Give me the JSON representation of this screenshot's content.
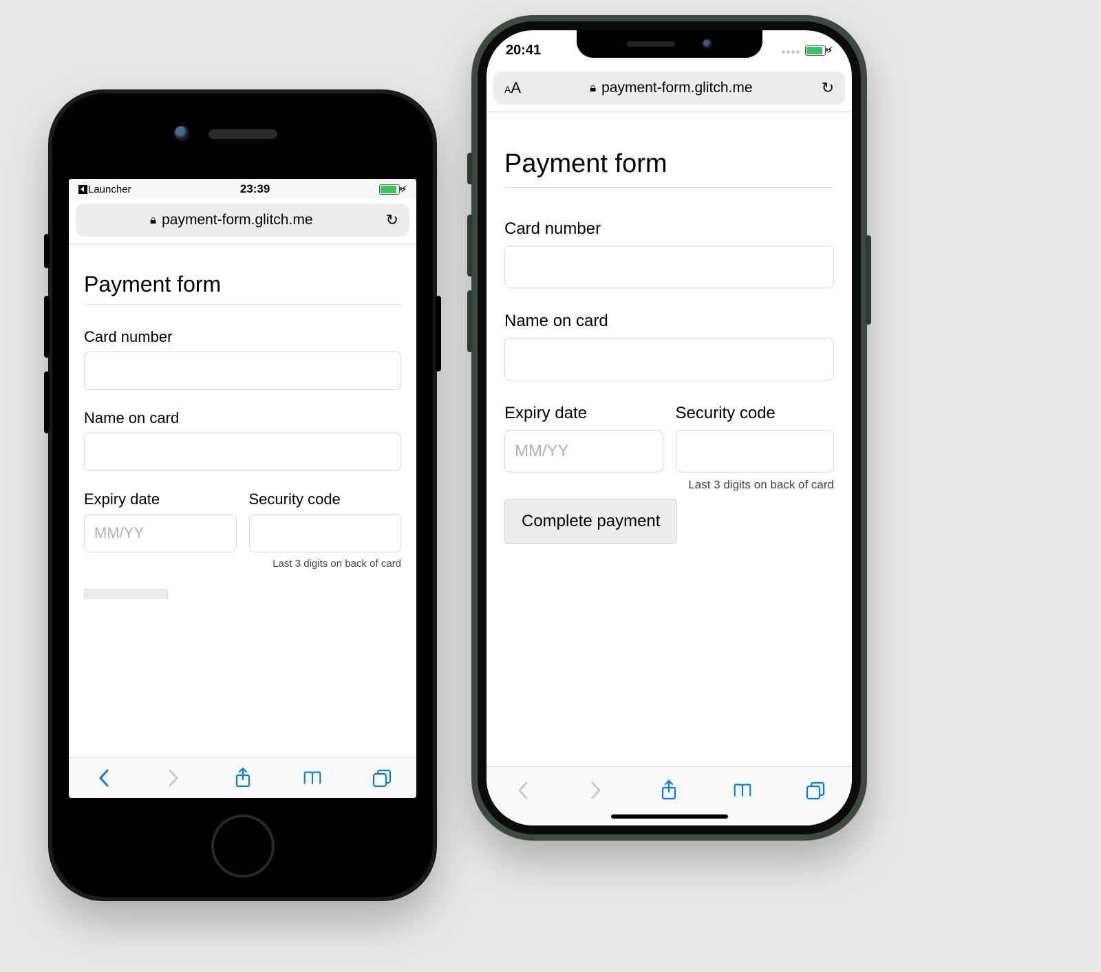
{
  "left": {
    "status": {
      "back_label": "Launcher",
      "time": "23:39"
    },
    "urlbar": {
      "host": "payment-form.glitch.me"
    },
    "form": {
      "heading": "Payment form",
      "card_number_label": "Card number",
      "name_label": "Name on card",
      "expiry_label": "Expiry date",
      "expiry_placeholder": "MM/YY",
      "cvc_label": "Security code",
      "cvc_hint": "Last 3 digits on back of card"
    }
  },
  "right": {
    "status": {
      "time": "20:41"
    },
    "urlbar": {
      "reader_label": "AA",
      "host": "payment-form.glitch.me"
    },
    "form": {
      "heading": "Payment form",
      "card_number_label": "Card number",
      "name_label": "Name on card",
      "expiry_label": "Expiry date",
      "expiry_placeholder": "MM/YY",
      "cvc_label": "Security code",
      "cvc_hint": "Last 3 digits on back of card",
      "submit_label": "Complete payment"
    }
  }
}
